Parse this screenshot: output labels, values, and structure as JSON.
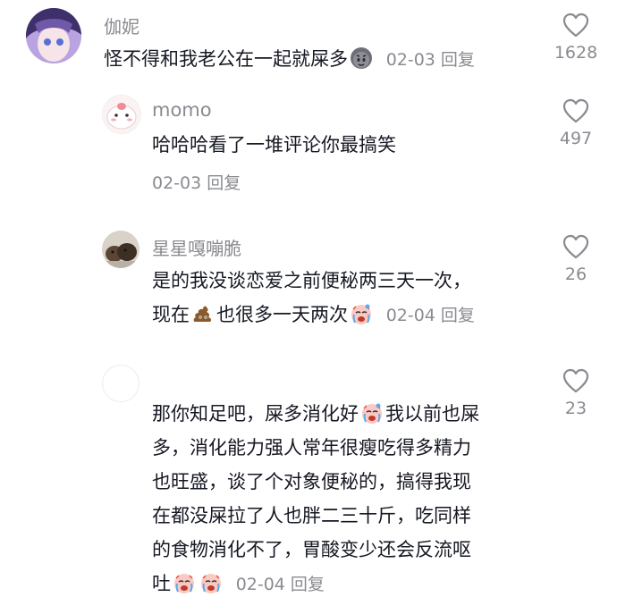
{
  "comments": [
    {
      "author": "伽妮",
      "text": "怪不得和我老公在一起就屎多",
      "date": "02-03",
      "reply_label": "回复",
      "likes": "1628"
    },
    {
      "author": "momo",
      "text": "哈哈哈看了一堆评论你最搞笑",
      "date": "02-03",
      "reply_label": "回复",
      "likes": "497"
    },
    {
      "author": "星星嘎嘣脆",
      "text_line1": "是的我没谈恋爱之前便秘两三天一次，",
      "text_line2a": "现在",
      "text_line2b": "也很多一天两次",
      "date": "02-04",
      "reply_label": "回复",
      "likes": "26"
    },
    {
      "author": "",
      "line1a": "那你知足吧，屎多消化好",
      "line1b": "我以前也屎",
      "line2": "多，消化能力强人常年很瘦吃得多精力",
      "line3": "也旺盛，谈了个对象便秘的，搞得我现",
      "line4": "在都没屎拉了人也胖二三十斤，吃同样",
      "line5": "的食物消化不了，胃酸变少还会反流呕",
      "line6": "吐",
      "date": "02-04",
      "reply_label": "回复",
      "likes": "23"
    }
  ],
  "icons": {
    "like": "heart-outline-icon",
    "emoji_1": "smirk-face-emoji",
    "emoji_2": "poop-emoji",
    "emoji_3": "crying-face-emoji"
  },
  "colors": {
    "text": "#161823",
    "meta": "#8a8b91",
    "icon": "#8a8b91"
  }
}
